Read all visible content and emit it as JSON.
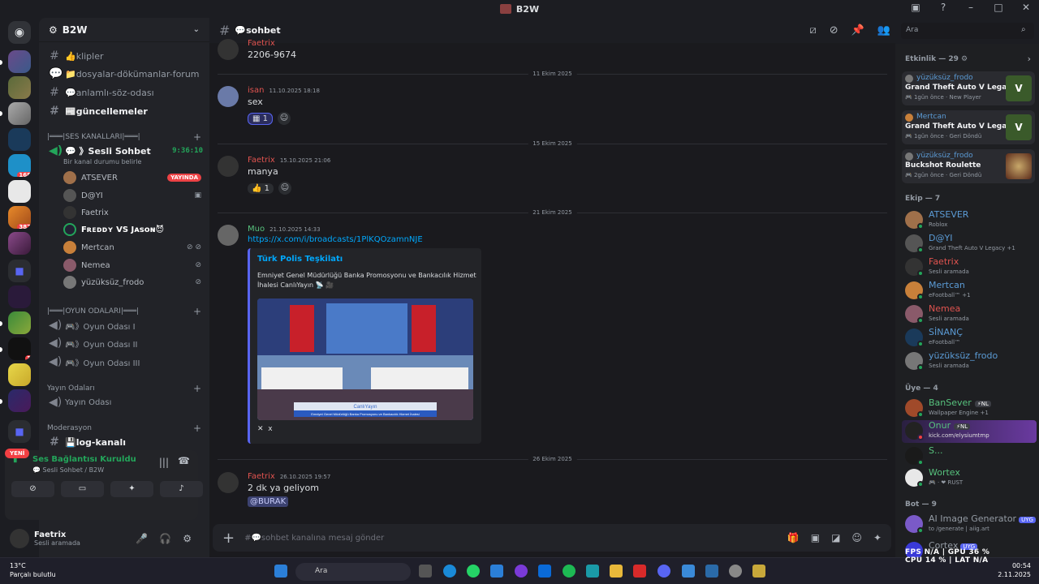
{
  "window": {
    "title": "B2W"
  },
  "server": {
    "name": "B2W"
  },
  "server_badges": {
    "b1": "168",
    "b2": "387",
    "b3": "3"
  },
  "channels": {
    "text": [
      {
        "label": "👍klipler"
      },
      {
        "label": "📁dosyalar-dökümanlar-forum"
      },
      {
        "label": "💬anlamlı-söz-odası"
      },
      {
        "label": "📰güncellemeler"
      }
    ],
    "voice_category": "|═══|SES KANALLARI|═══|",
    "sesli_sohbet": {
      "label": "💬 》Sesli Sohbet",
      "timer": "9:36:10",
      "status": "Bir kanal durumu belirle"
    },
    "voice_users": [
      {
        "name": "ATSEVER",
        "live": "YAYINDA"
      },
      {
        "name": "D@YI"
      },
      {
        "name": "Faetrix"
      },
      {
        "name": "Fʀᴇᴅᴅʏ VS Jᴀsᴏɴ😈"
      },
      {
        "name": "Mertcan"
      },
      {
        "name": "Nemea"
      },
      {
        "name": "yüzüksüz_frodo"
      }
    ],
    "game_category": "|═══|OYUN ODALARI|═══|",
    "game_rooms": [
      {
        "label": "🎮》Oyun Odası I"
      },
      {
        "label": "🎮》Oyun Odası II"
      },
      {
        "label": "🎮》Oyun Odası III"
      }
    ],
    "yayin_category": "Yayın Odaları",
    "yayin_room": "Yayın Odası",
    "mod_category": "Moderasyon",
    "log": "💾log-kanalı"
  },
  "new_badge": "YENİ",
  "voice_panel": {
    "status": "Ses Bağlantısı Kuruldu",
    "sub": "💬 Sesli Sohbet / B2W"
  },
  "me": {
    "name": "Faetrix",
    "status": "Sesli aramada"
  },
  "chat": {
    "channel": "💬sohbet",
    "placeholder": "#💬sohbet kanalına mesaj gönder",
    "messages": [
      {
        "author": "Faetrix",
        "time": "",
        "body": "2206-9674"
      },
      {
        "divider": "11 Ekim 2025"
      },
      {
        "author": "isan",
        "time": "11.10.2025 18:18",
        "body": "sex",
        "reaction": "1"
      },
      {
        "divider": "15 Ekim 2025"
      },
      {
        "author": "Faetrix",
        "time": "15.10.2025 21:06",
        "body": "manya",
        "reaction": "👍 1"
      },
      {
        "divider": "21 Ekim 2025"
      },
      {
        "author": "Muo",
        "time": "21.10.2025 14:33",
        "body": "https://x.com/i/broadcasts/1PlKQOzamnNJE"
      },
      {
        "divider": "26 Ekim 2025"
      },
      {
        "author": "Faetrix",
        "time": "26.10.2025 19:57",
        "body": "2 dk ya geliyom",
        "mention": "@BURAK"
      }
    ],
    "embed": {
      "title": "Türk Polis Teşkilatı",
      "desc": "Emniyet Genel Müdürlüğü Banka Promosyonu ve Bankacılık Hizmet İhalesi CanlıYayın 📡 🎥",
      "caption": "CanlıYayın",
      "subcaption": "Emniyet Genel Müdürlüğü Banka Promosyonu ve Bankacılık Hizmet İhalesi",
      "footer": "x"
    }
  },
  "search": {
    "placeholder": "Ara"
  },
  "members": {
    "activity_title": "Etkinlik — 29",
    "activities": [
      {
        "user": "yüzüksüz_frodo",
        "game": "Grand Theft Auto V Legacy",
        "time": "1gün önce",
        "note": "New Player"
      },
      {
        "user": "Mertcan",
        "game": "Grand Theft Auto V Legacy",
        "time": "1gün önce",
        "note": "Geri Döndü"
      },
      {
        "user": "yüzüksüz_frodo",
        "game": "Buckshot Roulette",
        "time": "2gün önce",
        "note": "Geri Döndü"
      }
    ],
    "ekip_title": "Ekip — 7",
    "ekip": [
      {
        "name": "ATSEVER",
        "status": "Roblox",
        "color": "#5b9bd5"
      },
      {
        "name": "D@YI",
        "status": "Grand Theft Auto V Legacy +1",
        "color": "#5b9bd5"
      },
      {
        "name": "Faetrix",
        "status": "Sesli aramada",
        "color": "#e0534f"
      },
      {
        "name": "Mertcan",
        "status": "eFootball™ +1",
        "color": "#5b9bd5"
      },
      {
        "name": "Nemea",
        "status": "Sesli aramada",
        "color": "#e0534f"
      },
      {
        "name": "SİNANÇ",
        "status": "eFootball™",
        "color": "#5b9bd5"
      },
      {
        "name": "yüzüksüz_frodo",
        "status": "Sesli aramada",
        "color": "#5b9bd5"
      }
    ],
    "uye_title": "Üye — 4",
    "uye": [
      {
        "name": "BanSever",
        "tag": "NL",
        "status": "Wallpaper Engine +1",
        "color": "#57c27d"
      },
      {
        "name": "Onur",
        "tag": "NL",
        "status": "kick.com/elysiumtmp",
        "color": "#57c27d"
      },
      {
        "name": "S...",
        "status": "",
        "color": "#57c27d"
      },
      {
        "name": "Wortex",
        "status": "RUST",
        "color": "#57c27d"
      }
    ],
    "bot_title": "Bot — 9",
    "bots": [
      {
        "name": "AI Image Generator",
        "tag": "UYG",
        "status": "to /generate | aiig.art",
        "color": "#949ba4"
      },
      {
        "name": "Cortex",
        "tag": "UYG",
        "status": "",
        "color": "#949ba4"
      }
    ]
  },
  "taskbar": {
    "temp": "13°C",
    "weather": "Parçalı bulutlu",
    "search": "Ara",
    "time": "00:54",
    "date": "2.11.2025"
  },
  "perf": {
    "fps": "FPS",
    "fps_v": "N/A",
    "gpu": "GPU",
    "gpu_v": "36 %",
    "cpu": "CPU",
    "cpu_v": "14 %",
    "lat": "LAT",
    "lat_v": "N/A"
  }
}
